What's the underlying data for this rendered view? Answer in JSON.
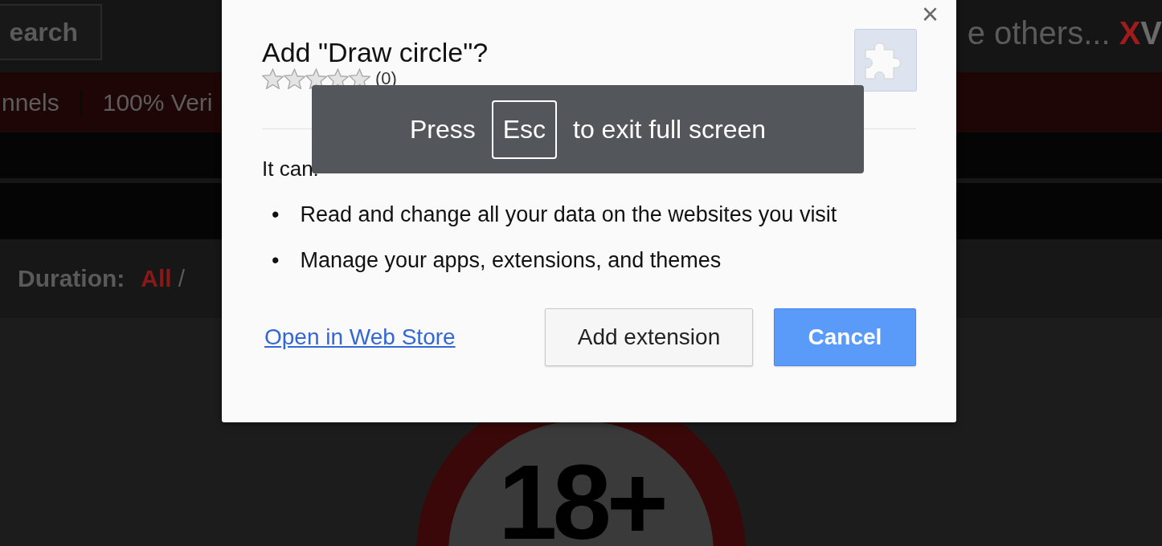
{
  "page": {
    "search_button": "earch",
    "tagline": "e others... ",
    "brand": [
      {
        "text": "X",
        "color": "#a01c1c"
      },
      {
        "text": "V",
        "color": "#6a6a6a"
      }
    ],
    "nav": [
      "nnels",
      "100% Veri"
    ],
    "filter": {
      "label": "Duration:",
      "options": [
        {
          "label": "All",
          "selected": true
        }
      ],
      "separator": "/"
    },
    "age_sign": "18+"
  },
  "dialog": {
    "title": "Add \"Draw circle\"?",
    "stars": 0,
    "rating_count": "(0)",
    "intro": "It can:",
    "permissions": [
      {
        "bullet": "•",
        "text": "Read and change all your data on the websites you visit"
      },
      {
        "bullet": "•",
        "text": "Manage your apps, extensions, and themes"
      }
    ],
    "link": "Open in Web Store",
    "buttons": [
      {
        "label": "Add extension",
        "primary": false
      },
      {
        "label": "Cancel",
        "primary": true
      }
    ],
    "close": "×"
  },
  "fullscreen_toast": {
    "before": "Press",
    "key": "Esc",
    "after": "to exit full screen"
  }
}
